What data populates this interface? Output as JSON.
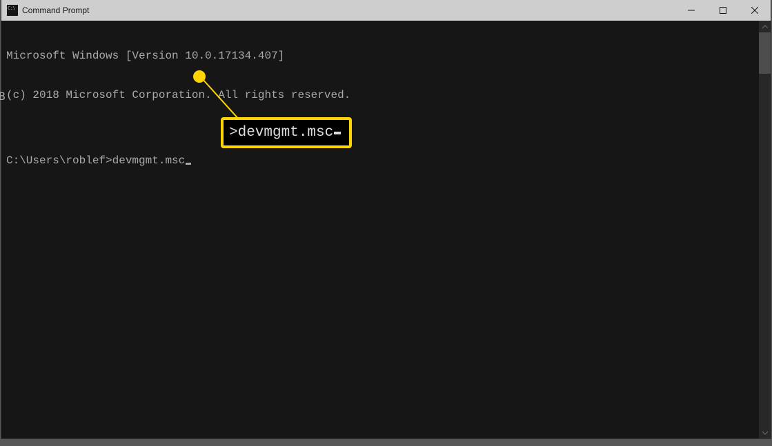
{
  "window": {
    "title": "Command Prompt"
  },
  "terminal": {
    "line1": "Microsoft Windows [Version 10.0.17134.407]",
    "line2": "(c) 2018 Microsoft Corporation. All rights reserved.",
    "blank": "",
    "prompt": "C:\\Users\\roblef>",
    "command": "devmgmt.msc"
  },
  "callout": {
    "text": ">devmgmt.msc"
  },
  "edge_letter": "B"
}
